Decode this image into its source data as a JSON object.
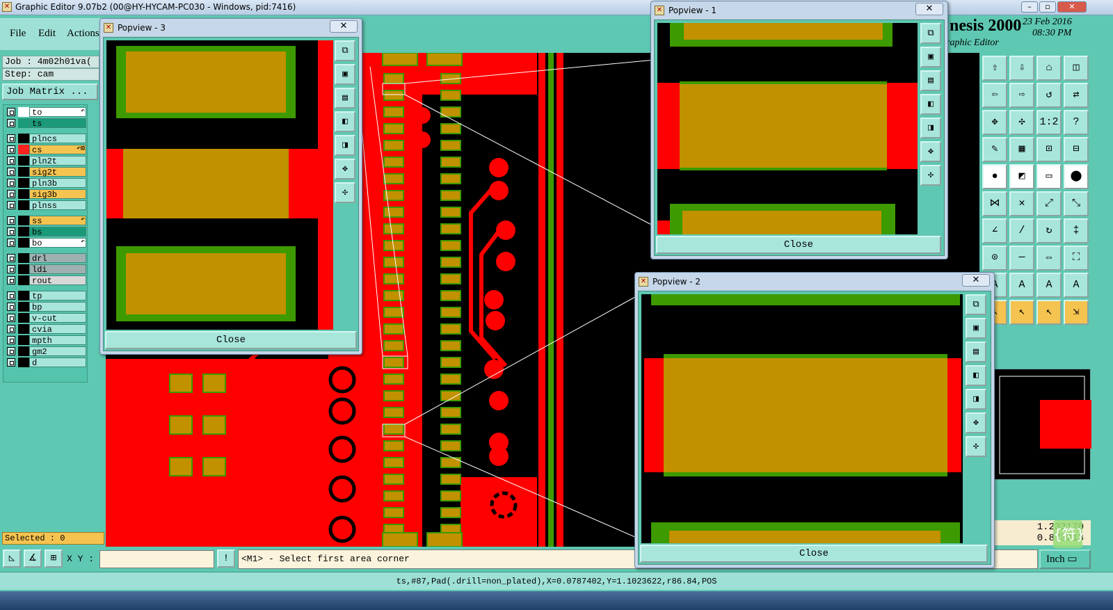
{
  "window": {
    "title": "Graphic Editor 9.07b2 (00@HY-HYCAM-PC030 - Windows, pid:7416)",
    "app_icon": "editor-app-icon",
    "controls": [
      "–",
      "▫",
      "✕"
    ]
  },
  "menu": [
    "File",
    "Edit",
    "Actions"
  ],
  "job": {
    "job_label": "Job : 4m02h01va(",
    "step_label": "Step: cam",
    "matrix_button": "Job Matrix ..."
  },
  "layers": [
    {
      "name": "to",
      "swatch": "#ffffff",
      "color": "#ffffff",
      "mark": "↶"
    },
    {
      "name": "ts",
      "swatch": "#1a9a78",
      "color": "#1a9a78",
      "mark": ""
    },
    {
      "name": "plncs",
      "swatch": "#000000",
      "color": "#a8e6dc",
      "mark": ""
    },
    {
      "name": "cs",
      "swatch": "#ff2020",
      "color": "#f5c350",
      "mark": "↶⊠"
    },
    {
      "name": "pln2t",
      "swatch": "#000000",
      "color": "#a8e6dc",
      "mark": ""
    },
    {
      "name": "sig2t",
      "swatch": "#000000",
      "color": "#f5c350",
      "mark": ""
    },
    {
      "name": "pln3b",
      "swatch": "#000000",
      "color": "#a8e6dc",
      "mark": ""
    },
    {
      "name": "sig3b",
      "swatch": "#000000",
      "color": "#f5c350",
      "mark": ""
    },
    {
      "name": "plnss",
      "swatch": "#000000",
      "color": "#a8e6dc",
      "mark": ""
    },
    {
      "name": "ss",
      "swatch": "#000000",
      "color": "#f5c350",
      "mark": "↶"
    },
    {
      "name": "bs",
      "swatch": "#000000",
      "color": "#1a9a78",
      "mark": ""
    },
    {
      "name": "bo",
      "swatch": "#000000",
      "color": "#ffffff",
      "mark": "↶"
    },
    {
      "name": "drl",
      "swatch": "#000000",
      "color": "#9fb0b0",
      "mark": ""
    },
    {
      "name": "ldi",
      "swatch": "#000000",
      "color": "#9fb0b0",
      "mark": ""
    },
    {
      "name": "rout",
      "swatch": "#000000",
      "color": "#d8d8d8",
      "mark": ""
    },
    {
      "name": "tp",
      "swatch": "#000000",
      "color": "#a8e6dc",
      "mark": ""
    },
    {
      "name": "bp",
      "swatch": "#000000",
      "color": "#a8e6dc",
      "mark": ""
    },
    {
      "name": "v-cut",
      "swatch": "#000000",
      "color": "#a8e6dc",
      "mark": ""
    },
    {
      "name": "cvia",
      "swatch": "#000000",
      "color": "#a8e6dc",
      "mark": ""
    },
    {
      "name": "mpth",
      "swatch": "#000000",
      "color": "#a8e6dc",
      "mark": ""
    },
    {
      "name": "gm2",
      "swatch": "#000000",
      "color": "#a8e6dc",
      "mark": ""
    },
    {
      "name": "d",
      "swatch": "#000000",
      "color": "#a8e6dc",
      "mark": ""
    }
  ],
  "selected": "Selected : 0",
  "logo": {
    "line1": "nesis 2000",
    "line2": "raphic Editor",
    "date": "23 Feb 2016",
    "time": "08:30 PM"
  },
  "coords": {
    "x": "1.233170",
    "y": "0.873213"
  },
  "cmd": {
    "xy_label": "X Y :",
    "xy_value": "",
    "bang": "!",
    "message": "<M1> - Select first area corner",
    "units": "Inch ▭"
  },
  "status": "ts,#87,Pad(.drill=non_plated),X=0.0787402,Y=1.1023622,r86.84,POS",
  "ime": "{符}",
  "popviews": [
    {
      "title": "Popview - 3",
      "close": "Close",
      "x_label": "✕"
    },
    {
      "title": "Popview - 1",
      "close": "Close",
      "x_label": "✕"
    },
    {
      "title": "Popview - 2",
      "close": "Close",
      "x_label": "✕"
    }
  ],
  "colors": {
    "copper": "#ff0000",
    "pad": "#c19100",
    "mask": "#3d9a00",
    "background": "#000000",
    "ui": "#5ec8b2"
  },
  "icons": {
    "toolbar": [
      "zoom-home-icon",
      "zoom-in-icon",
      "zoom-out-icon",
      "pan-icon",
      "undo-icon",
      "redo-icon",
      "ratio-icon",
      "help-icon",
      "measure-icon",
      "grid-icon",
      "snap-icon",
      "select-icon",
      "pad-icon",
      "line-icon",
      "arc-icon",
      "text-icon"
    ],
    "cmdbar": [
      "corner-snap-icon",
      "angle-icon",
      "grid-snap-icon"
    ]
  }
}
